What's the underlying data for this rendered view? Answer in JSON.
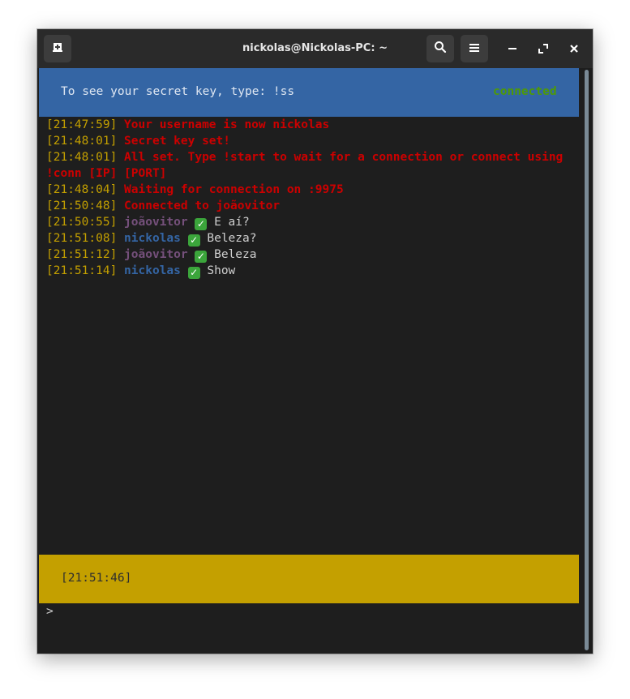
{
  "window": {
    "title": "nickolas@Nickolas-PC: ~"
  },
  "icons": {
    "new_tab": "new-tab-icon",
    "search": "search-icon",
    "menu": "hamburger-menu-icon",
    "minimize": "minimize-icon",
    "maximize": "maximize-icon",
    "close": "close-icon",
    "check": "check-mark-emoji"
  },
  "colors": {
    "info_bar": "#3465a4",
    "clock_bar": "#c4a000",
    "status_connected": "#4e9a06",
    "timestamp": "#c4a000",
    "system_message": "#cc0000",
    "user_joaovitor": "#75507b",
    "user_nickolas": "#3465a4"
  },
  "info_bar": {
    "text": "To see your secret key, type: !ss",
    "status": "connected"
  },
  "log": [
    {
      "time": "[21:47:59]",
      "text": "Your username is now nickolas"
    },
    {
      "time": "[21:48:01]",
      "text": "Secret key set!"
    },
    {
      "time": "[21:48:01]",
      "text": "All set. Type !start to wait for a connection or connect using"
    },
    {
      "time": "",
      "text": "!conn [IP] [PORT]"
    },
    {
      "time": "[21:48:04]",
      "text": "Waiting for connection on :9975"
    },
    {
      "time": "[21:50:48]",
      "text": "Connected to joãovitor"
    },
    {
      "time": "[21:50:55]",
      "user": "joãovitor",
      "check": "✓",
      "text": "E aí?"
    },
    {
      "time": "[21:51:08]",
      "user": "nickolas",
      "check": "✓",
      "text": "Beleza?"
    },
    {
      "time": "[21:51:12]",
      "user": "joãovitor",
      "check": "✓",
      "text": "Beleza"
    },
    {
      "time": "[21:51:14]",
      "user": "nickolas",
      "check": "✓",
      "text": "Show"
    }
  ],
  "clock_bar": {
    "time": "[21:51:46]"
  },
  "prompt": {
    "symbol": ">",
    "value": ""
  }
}
